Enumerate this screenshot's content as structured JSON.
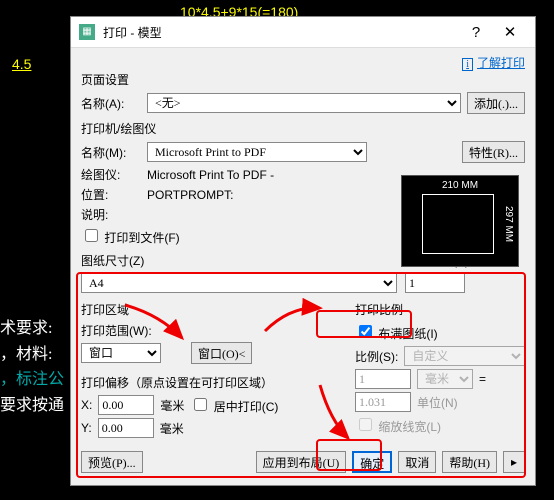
{
  "bg": {
    "formula": "10*4.5+9*15(=180)",
    "dim": "4.5"
  },
  "req": {
    "t0": "术要求:",
    "t1": "，材料:",
    "t2": "，标注公",
    "t3": "要求按通"
  },
  "dlg": {
    "title": "打印 - 模型",
    "help": "?",
    "close": "✕",
    "learn": "了解打印",
    "page_setup": "页面设置",
    "name_a": "名称(A):",
    "name_a_val": "<无>",
    "add": "添加(.)...",
    "printer": "打印机/绘图仪",
    "name_m": "名称(M):",
    "name_m_val": "Microsoft Print to PDF",
    "props": "特性(R)...",
    "plotter": "绘图仪:",
    "plotter_val": "Microsoft Print To PDF -",
    "loc": "位置:",
    "loc_val": "PORTPROMPT:",
    "desc": "说明:",
    "to_file": "打印到文件(F)",
    "paper_w": "210 MM",
    "paper_h": "297 MM",
    "paper_size": "图纸尺寸(Z)",
    "paper_val": "A4",
    "copies": "打印份数(B)",
    "copies_val": "1",
    "area": "打印区域",
    "range": "打印范围(W):",
    "range_val": "窗口",
    "win_btn": "窗口(O)<",
    "scale": "打印比例",
    "fit": "布满图纸(I)",
    "ratio": "比例(S):",
    "ratio_val": "自定义",
    "mm": "毫米",
    "unit": "1",
    "factor": "1.031",
    "unit_lbl": "单位(N)",
    "lw": "缩放线宽(L)",
    "offset": "打印偏移（原点设置在可打印区域）",
    "x": "X:",
    "y": "Y:",
    "xv": "0.00",
    "yv": "0.00",
    "center": "居中打印(C)",
    "preview": "预览(P)...",
    "apply": "应用到布局(U)",
    "ok": "确定",
    "cancel": "取消",
    "help_btn": "帮助(H)"
  }
}
